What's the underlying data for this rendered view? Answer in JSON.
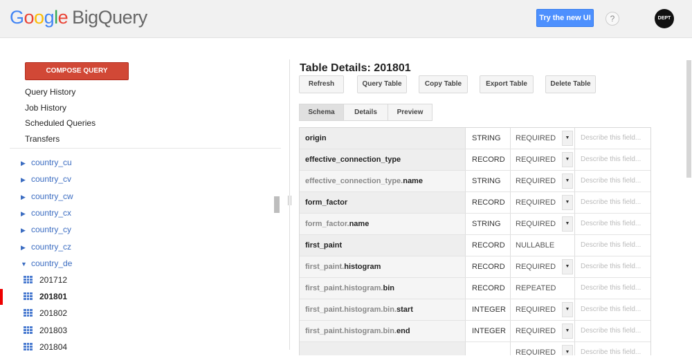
{
  "header": {
    "logo": {
      "g1": "G",
      "g2": "o",
      "g3": "o",
      "g4": "g",
      "g5": "l",
      "g6": "e",
      "product": "BigQuery"
    },
    "try_new_ui": "Try the new UI",
    "help": "?",
    "avatar": "DEPT"
  },
  "sidebar": {
    "compose": "COMPOSE QUERY",
    "nav": [
      "Query History",
      "Job History",
      "Scheduled Queries",
      "Transfers"
    ],
    "datasets": [
      "country_cu",
      "country_cv",
      "country_cw",
      "country_cx",
      "country_cy",
      "country_cz"
    ],
    "expanded_dataset": "country_de",
    "tables": [
      "201712",
      "201801",
      "201802",
      "201803",
      "201804"
    ],
    "active_table": "201801"
  },
  "main": {
    "title": "Table Details: 201801",
    "buttons": {
      "refresh": "Refresh",
      "query": "Query Table",
      "copy": "Copy Table",
      "export": "Export Table",
      "delete": "Delete Table"
    },
    "tabs": {
      "schema": "Schema",
      "details": "Details",
      "preview": "Preview"
    },
    "active_tab": "Schema",
    "description_placeholder": "Describe this field...",
    "schema": [
      {
        "prefix": "",
        "name": "origin",
        "type": "STRING",
        "mode": "REQUIRED"
      },
      {
        "prefix": "",
        "name": "effective_connection_type",
        "type": "RECORD",
        "mode": "REQUIRED"
      },
      {
        "prefix": "effective_connection_type.",
        "name": "name",
        "type": "STRING",
        "mode": "REQUIRED"
      },
      {
        "prefix": "",
        "name": "form_factor",
        "type": "RECORD",
        "mode": "REQUIRED"
      },
      {
        "prefix": "form_factor.",
        "name": "name",
        "type": "STRING",
        "mode": "REQUIRED"
      },
      {
        "prefix": "",
        "name": "first_paint",
        "type": "RECORD",
        "mode": "NULLABLE"
      },
      {
        "prefix": "first_paint.",
        "name": "histogram",
        "type": "RECORD",
        "mode": "REQUIRED"
      },
      {
        "prefix": "first_paint.histogram.",
        "name": "bin",
        "type": "RECORD",
        "mode": "REPEATED"
      },
      {
        "prefix": "first_paint.histogram.bin.",
        "name": "start",
        "type": "INTEGER",
        "mode": "REQUIRED"
      },
      {
        "prefix": "first_paint.histogram.bin.",
        "name": "end",
        "type": "INTEGER",
        "mode": "REQUIRED"
      },
      {
        "prefix": "",
        "name": "",
        "type": "",
        "mode": "REQUIRED"
      }
    ]
  }
}
